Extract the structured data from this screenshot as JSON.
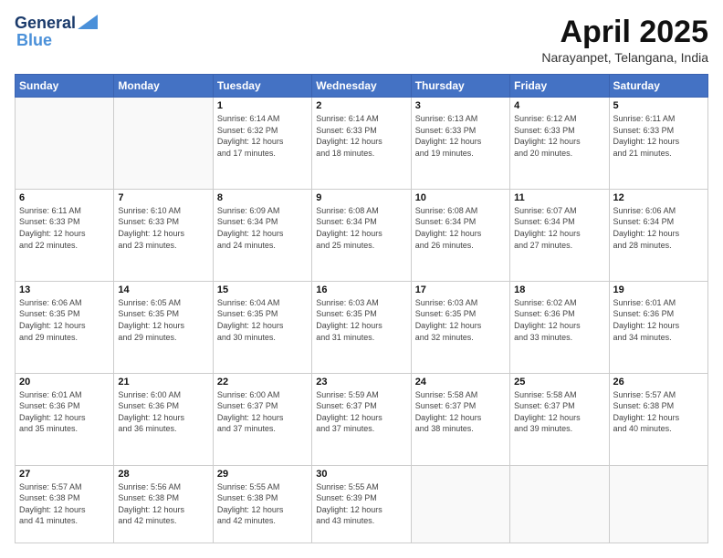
{
  "logo": {
    "line1": "General",
    "line2": "Blue"
  },
  "header": {
    "title": "April 2025",
    "subtitle": "Narayanpet, Telangana, India"
  },
  "weekdays": [
    "Sunday",
    "Monday",
    "Tuesday",
    "Wednesday",
    "Thursday",
    "Friday",
    "Saturday"
  ],
  "weeks": [
    [
      {
        "day": "",
        "info": ""
      },
      {
        "day": "",
        "info": ""
      },
      {
        "day": "1",
        "info": "Sunrise: 6:14 AM\nSunset: 6:32 PM\nDaylight: 12 hours\nand 17 minutes."
      },
      {
        "day": "2",
        "info": "Sunrise: 6:14 AM\nSunset: 6:33 PM\nDaylight: 12 hours\nand 18 minutes."
      },
      {
        "day": "3",
        "info": "Sunrise: 6:13 AM\nSunset: 6:33 PM\nDaylight: 12 hours\nand 19 minutes."
      },
      {
        "day": "4",
        "info": "Sunrise: 6:12 AM\nSunset: 6:33 PM\nDaylight: 12 hours\nand 20 minutes."
      },
      {
        "day": "5",
        "info": "Sunrise: 6:11 AM\nSunset: 6:33 PM\nDaylight: 12 hours\nand 21 minutes."
      }
    ],
    [
      {
        "day": "6",
        "info": "Sunrise: 6:11 AM\nSunset: 6:33 PM\nDaylight: 12 hours\nand 22 minutes."
      },
      {
        "day": "7",
        "info": "Sunrise: 6:10 AM\nSunset: 6:33 PM\nDaylight: 12 hours\nand 23 minutes."
      },
      {
        "day": "8",
        "info": "Sunrise: 6:09 AM\nSunset: 6:34 PM\nDaylight: 12 hours\nand 24 minutes."
      },
      {
        "day": "9",
        "info": "Sunrise: 6:08 AM\nSunset: 6:34 PM\nDaylight: 12 hours\nand 25 minutes."
      },
      {
        "day": "10",
        "info": "Sunrise: 6:08 AM\nSunset: 6:34 PM\nDaylight: 12 hours\nand 26 minutes."
      },
      {
        "day": "11",
        "info": "Sunrise: 6:07 AM\nSunset: 6:34 PM\nDaylight: 12 hours\nand 27 minutes."
      },
      {
        "day": "12",
        "info": "Sunrise: 6:06 AM\nSunset: 6:34 PM\nDaylight: 12 hours\nand 28 minutes."
      }
    ],
    [
      {
        "day": "13",
        "info": "Sunrise: 6:06 AM\nSunset: 6:35 PM\nDaylight: 12 hours\nand 29 minutes."
      },
      {
        "day": "14",
        "info": "Sunrise: 6:05 AM\nSunset: 6:35 PM\nDaylight: 12 hours\nand 29 minutes."
      },
      {
        "day": "15",
        "info": "Sunrise: 6:04 AM\nSunset: 6:35 PM\nDaylight: 12 hours\nand 30 minutes."
      },
      {
        "day": "16",
        "info": "Sunrise: 6:03 AM\nSunset: 6:35 PM\nDaylight: 12 hours\nand 31 minutes."
      },
      {
        "day": "17",
        "info": "Sunrise: 6:03 AM\nSunset: 6:35 PM\nDaylight: 12 hours\nand 32 minutes."
      },
      {
        "day": "18",
        "info": "Sunrise: 6:02 AM\nSunset: 6:36 PM\nDaylight: 12 hours\nand 33 minutes."
      },
      {
        "day": "19",
        "info": "Sunrise: 6:01 AM\nSunset: 6:36 PM\nDaylight: 12 hours\nand 34 minutes."
      }
    ],
    [
      {
        "day": "20",
        "info": "Sunrise: 6:01 AM\nSunset: 6:36 PM\nDaylight: 12 hours\nand 35 minutes."
      },
      {
        "day": "21",
        "info": "Sunrise: 6:00 AM\nSunset: 6:36 PM\nDaylight: 12 hours\nand 36 minutes."
      },
      {
        "day": "22",
        "info": "Sunrise: 6:00 AM\nSunset: 6:37 PM\nDaylight: 12 hours\nand 37 minutes."
      },
      {
        "day": "23",
        "info": "Sunrise: 5:59 AM\nSunset: 6:37 PM\nDaylight: 12 hours\nand 37 minutes."
      },
      {
        "day": "24",
        "info": "Sunrise: 5:58 AM\nSunset: 6:37 PM\nDaylight: 12 hours\nand 38 minutes."
      },
      {
        "day": "25",
        "info": "Sunrise: 5:58 AM\nSunset: 6:37 PM\nDaylight: 12 hours\nand 39 minutes."
      },
      {
        "day": "26",
        "info": "Sunrise: 5:57 AM\nSunset: 6:38 PM\nDaylight: 12 hours\nand 40 minutes."
      }
    ],
    [
      {
        "day": "27",
        "info": "Sunrise: 5:57 AM\nSunset: 6:38 PM\nDaylight: 12 hours\nand 41 minutes."
      },
      {
        "day": "28",
        "info": "Sunrise: 5:56 AM\nSunset: 6:38 PM\nDaylight: 12 hours\nand 42 minutes."
      },
      {
        "day": "29",
        "info": "Sunrise: 5:55 AM\nSunset: 6:38 PM\nDaylight: 12 hours\nand 42 minutes."
      },
      {
        "day": "30",
        "info": "Sunrise: 5:55 AM\nSunset: 6:39 PM\nDaylight: 12 hours\nand 43 minutes."
      },
      {
        "day": "",
        "info": ""
      },
      {
        "day": "",
        "info": ""
      },
      {
        "day": "",
        "info": ""
      }
    ]
  ]
}
